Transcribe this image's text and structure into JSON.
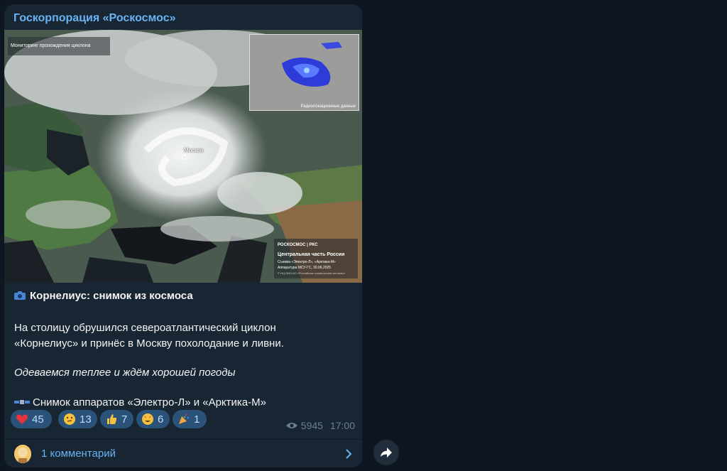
{
  "channel": {
    "name": "Госкорпорация «Роскосмос»"
  },
  "photo": {
    "label": "Мониторинг прохождения циклона",
    "inset_caption": "Радиолокационные данные",
    "city": "Москва",
    "logo": {
      "brand": "РОСКОСМОС | РКС",
      "title": "Центральная часть России",
      "line1": "Съемка «Электро-Л», «Арктика-М»",
      "line2": "Аппаратура МСУ-ГС, 30.06.2025",
      "line3": "© НЦ ОМЗ АО «Российские космические системы»"
    }
  },
  "post": {
    "title": "Корнелиус: снимок из космоса",
    "body_line1": "На столицу обрушился североатлантический циклон",
    "body_line2": "«Корнелиус» и принёс в Москву похолодание и ливни.",
    "italic": "Одеваемся теплее и ждём хорошей погоды",
    "source": "Снимок аппаратов «Электро-Л» и «Арктика-М»"
  },
  "reactions": [
    {
      "emoji": "heart-icon",
      "count": "45"
    },
    {
      "emoji": "thinking-face-icon",
      "count": "13"
    },
    {
      "emoji": "thumbs-up-icon",
      "count": "7"
    },
    {
      "emoji": "star-struck-icon",
      "count": "6"
    },
    {
      "emoji": "party-popper-icon",
      "count": "1"
    }
  ],
  "meta": {
    "views": "5945",
    "time": "17:00"
  },
  "comments": {
    "label": "1 комментарий"
  },
  "colors": {
    "accent": "#6ab3f3",
    "bubble": "#182533",
    "background": "#0e1621",
    "reaction_bg": "#2b5278"
  }
}
